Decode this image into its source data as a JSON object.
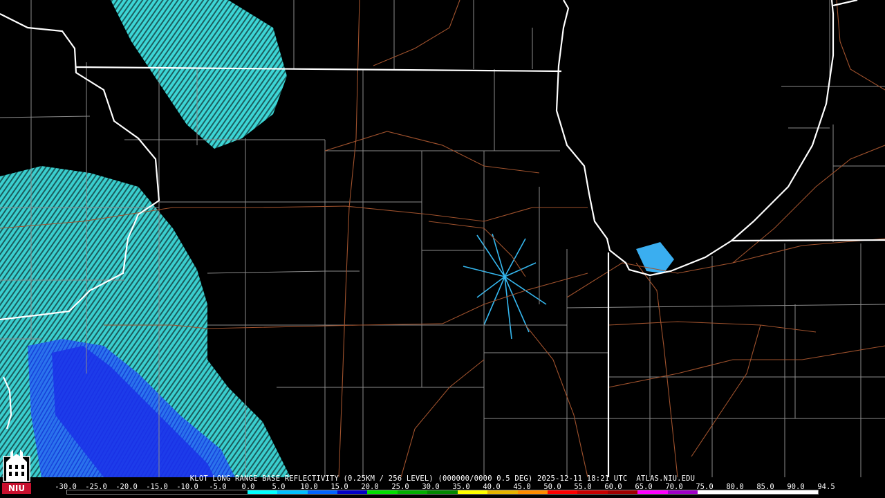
{
  "product": {
    "caption": "KLOT LONG RANGE BASE REFLECTIVITY (0.25KM / 256 LEVEL) (000000/0000 0.5 DEG) 2025-12-11 18:21 UTC  ATLAS.NIU.EDU"
  },
  "legend": {
    "ticks": [
      "-30.0",
      "-25.0",
      "-20.0",
      "-15.0",
      "-10.0",
      "-5.0",
      "0.0",
      "5.0",
      "10.0",
      "15.0",
      "20.0",
      "25.0",
      "30.0",
      "35.0",
      "40.0",
      "45.0",
      "50.0",
      "55.0",
      "60.0",
      "65.0",
      "70.0",
      "75.0",
      "80.0",
      "85.0",
      "90.0",
      "94.5"
    ],
    "colors": [
      "#000000",
      "#000000",
      "#000000",
      "#000000",
      "#000000",
      "#000000",
      "#00ffff",
      "#00bfff",
      "#0064ff",
      "#0000c8",
      "#00e000",
      "#00b000",
      "#008800",
      "#ffff00",
      "#e6b400",
      "#ff8c00",
      "#ff0000",
      "#c80000",
      "#a00000",
      "#ff00ff",
      "#a000c8",
      "#ffffff",
      "#ffffff",
      "#ffffff",
      "#ffffff"
    ]
  },
  "logo": {
    "text": "NIU",
    "color": "#c8102e"
  },
  "map_colors": {
    "state_borders": "#ffffff",
    "county_lines": "#8c8c8c",
    "highways": "#a0522d",
    "echo_light": "#3fe0e0",
    "echo_mid": "#1e90ff",
    "echo_heavy": "#1020e0"
  }
}
